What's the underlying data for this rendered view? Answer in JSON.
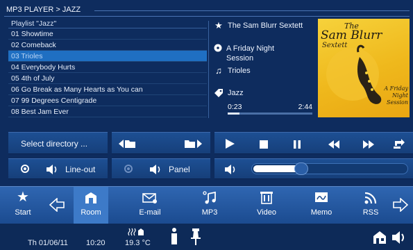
{
  "breadcrumb": "MP3 PLAYER > JAZZ",
  "playlist": {
    "header": "Playlist \"Jazz\"",
    "tracks": [
      "01 Showtime",
      "02 Comeback",
      "03 Trioles",
      "04 Everybody Hurts",
      "05 4th of July",
      "06 Go Break as Many Hearts as You can",
      "07 99 Degrees Centigrade",
      "08 Best Jam Ever"
    ],
    "selected_index": 2
  },
  "now_playing": {
    "artist": "The Sam Blurr Sextett",
    "album": "A Friday Night Session",
    "track": "Trioles",
    "genre": "Jazz",
    "elapsed": "0:23",
    "duration": "2:44",
    "progress_fraction": 0.14
  },
  "album_art": {
    "line1": "The",
    "line2": "Sam Blurr",
    "line3": "Sextett",
    "side_text": "A Friday Night Session"
  },
  "controls": {
    "select_directory": "Select directory ...",
    "line_out_label": "Line-out",
    "panel_label": "Panel",
    "volume_fraction": 0.3
  },
  "nav": {
    "items": [
      {
        "label": "Start",
        "icon": "star-icon"
      },
      {
        "label": "Room",
        "icon": "room-icon"
      },
      {
        "label": "E-mail",
        "icon": "email-icon"
      },
      {
        "label": "MP3",
        "icon": "music-icon"
      },
      {
        "label": "Video",
        "icon": "film-icon"
      },
      {
        "label": "Memo",
        "icon": "memo-icon"
      },
      {
        "label": "RSS",
        "icon": "rss-icon"
      }
    ]
  },
  "status": {
    "date": "Th 01/06/11",
    "time": "10:20",
    "temperature": "19.3 °C"
  },
  "colors": {
    "background": "#0e2c5e",
    "bar": "#1d4f93",
    "nav": "#2f66b1",
    "selected_row": "#1f6fc2",
    "album_yellow": "#f6d23b"
  }
}
